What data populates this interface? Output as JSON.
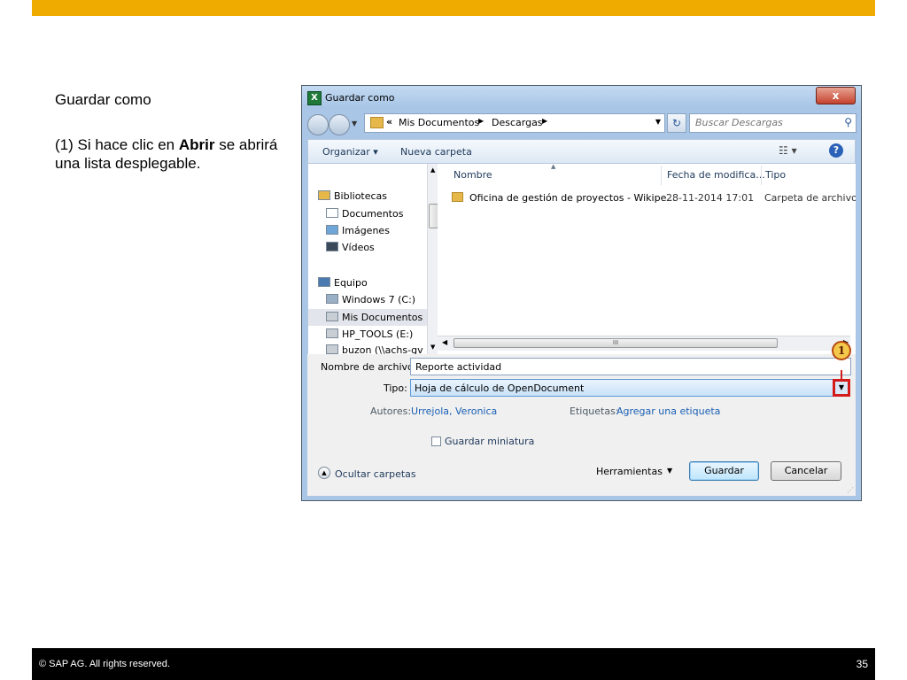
{
  "slide": {
    "title": "Guardar como",
    "note_prefix": "(1) Si hace clic en ",
    "note_bold": "Abrir",
    "note_suffix": " se abrirá una lista desplegable.",
    "footer_copyright": "©  SAP AG. All rights reserved.",
    "page_number": "35",
    "accent_color": "#f0ab00"
  },
  "dialog": {
    "title": "Guardar como",
    "app_icon": "excel-icon",
    "close_label": "x",
    "address": {
      "prefix": "«",
      "crumbs": [
        "Mis Documentos",
        "Descargas"
      ]
    },
    "search_placeholder": "Buscar Descargas",
    "toolbar": {
      "organize": "Organizar ▾",
      "new_folder": "Nueva carpeta",
      "views": "☷ ▾",
      "help": "?"
    },
    "nav": {
      "libraries": "Bibliotecas",
      "documents": "Documentos",
      "images": "Imágenes",
      "videos": "Vídeos",
      "computer": "Equipo",
      "drive_c": "Windows 7 (C:)",
      "my_docs": "Mis Documentos",
      "drive_e": "HP_TOOLS (E:)",
      "network": "buzon (\\\\achs-gv"
    },
    "columns": [
      "Nombre",
      "Fecha de modifica...",
      "Tipo"
    ],
    "files": [
      {
        "name": "Oficina de gestión de proyectos - Wikipe...",
        "date": "28-11-2014 17:01",
        "type": "Carpeta de archivos"
      }
    ],
    "scroll_grip": "III",
    "form": {
      "filename_label": "Nombre de archivo:",
      "filename_value": "Reporte actividad",
      "type_label": "Tipo:",
      "type_value": "Hoja de cálculo de OpenDocument",
      "authors_label": "Autores:",
      "authors_value": "Urrejola, Veronica",
      "tags_label": "Etiquetas:",
      "tags_value": "Agregar una etiqueta",
      "thumbnail_label": "Guardar miniatura",
      "thumbnail_checked": false,
      "hide_folders": "Ocultar carpetas",
      "tools": "Herramientas",
      "save": "Guardar",
      "cancel": "Cancelar"
    },
    "callout_number": "1",
    "highlight_color": "#d21b1b"
  }
}
